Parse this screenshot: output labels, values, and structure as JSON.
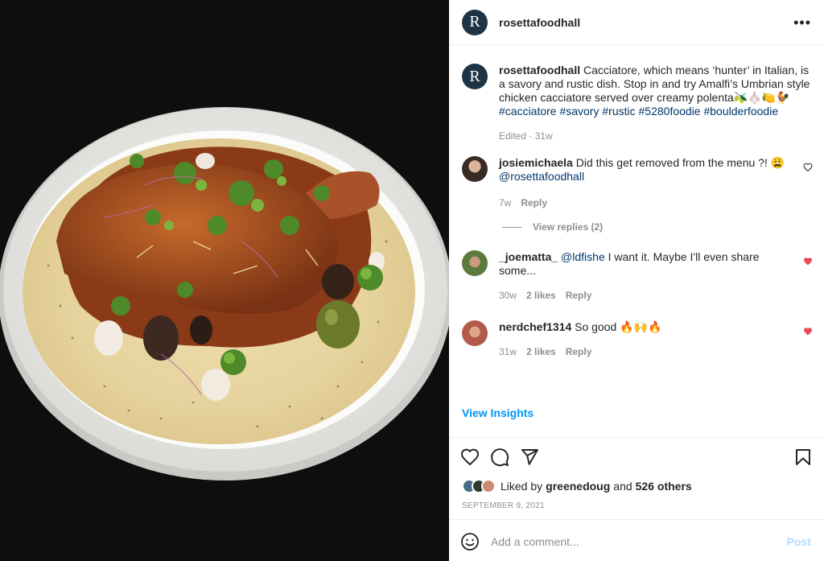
{
  "post": {
    "username": "rosettafoodhall",
    "avatar_letter": "R",
    "more_label": "•••"
  },
  "caption": {
    "username": "rosettafoodhall",
    "text": "Cacciatore, which means ‘hunter’ in Italian, is a savory and rustic dish. Stop in and try Amalfi’s Umbrian style chicken cacciatore served over creamy polenta",
    "emojis": "🫒🧄🍋🐓",
    "hashtags": "#cacciatore #savory #rustic #5280foodie #boulderfoodie",
    "meta": "Edited · 31w"
  },
  "comments": [
    {
      "username": "josiemichaela",
      "text": "Did this get removed from the menu ?! 😩",
      "mention": "@rosettafoodhall",
      "time": "7w",
      "likes": "",
      "reply": "Reply",
      "view_replies": "View replies (2)",
      "liked": false
    },
    {
      "username": "_joematta_",
      "mention": "@ldfishe",
      "text": "I want it. Maybe I'll even share some...",
      "time": "30w",
      "likes": "2 likes",
      "reply": "Reply",
      "liked": true
    },
    {
      "username": "nerdchef1314",
      "text": "So good 🔥🙌🔥",
      "time": "31w",
      "likes": "2 likes",
      "reply": "Reply",
      "liked": true
    }
  ],
  "insights_label": "View Insights",
  "likes": {
    "prefix": "Liked by",
    "user": "greenedoug",
    "and": "and",
    "others": "526 others"
  },
  "date": "SEPTEMBER 9, 2021",
  "add_comment": {
    "placeholder": "Add a comment...",
    "post_label": "Post"
  },
  "colors": {
    "accent": "#0095f6",
    "heart_red": "#ed4956",
    "avatar_bg": "#1e3344",
    "post_disabled": "#b3dbff"
  },
  "icons": [
    "ellipsis-icon",
    "heart-icon",
    "comment-icon",
    "share-icon",
    "bookmark-icon",
    "emoji-icon"
  ]
}
